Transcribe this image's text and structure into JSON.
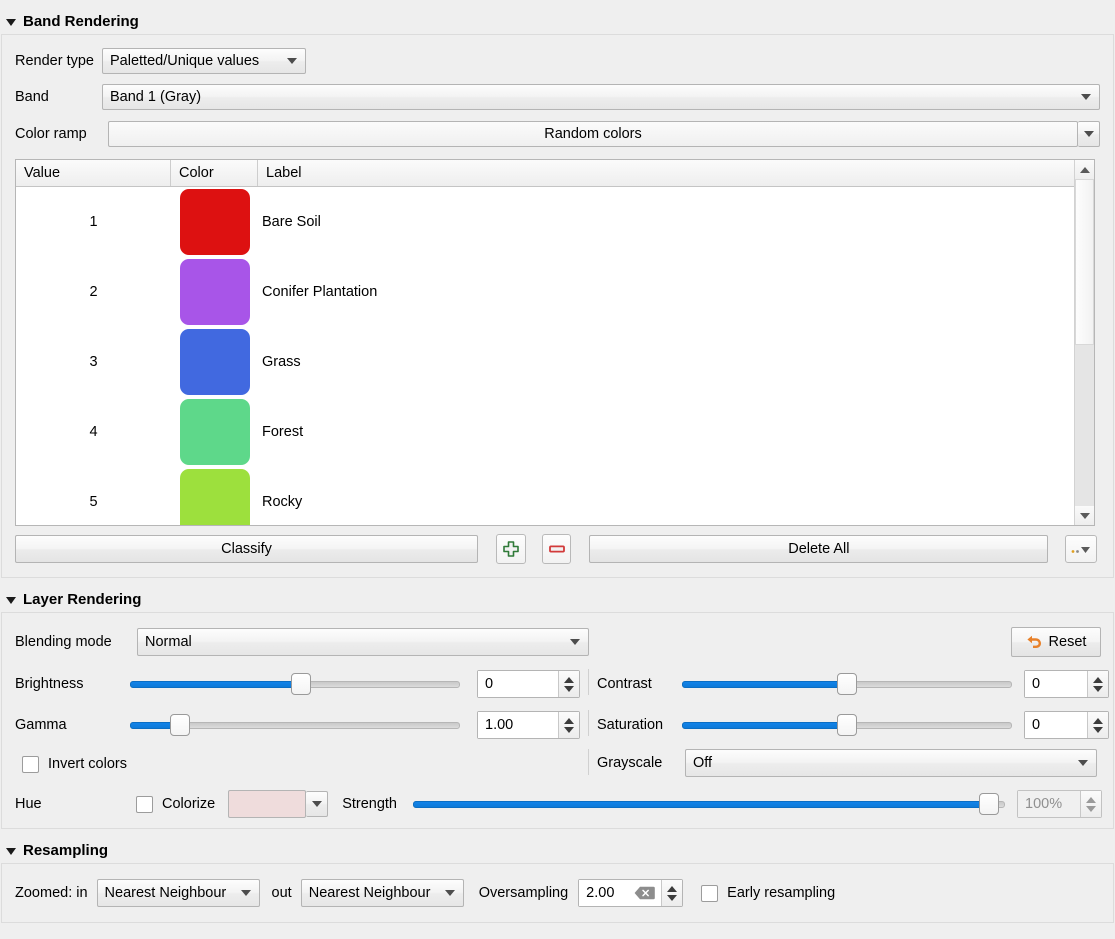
{
  "sections": {
    "band_rendering": {
      "title": "Band Rendering",
      "render_type_label": "Render type",
      "render_type_value": "Paletted/Unique values",
      "band_label": "Band",
      "band_value": "Band 1 (Gray)",
      "color_ramp_label": "Color ramp",
      "color_ramp_value": "Random colors",
      "table": {
        "columns": [
          "Value",
          "Color",
          "Label"
        ],
        "rows": [
          {
            "value": "1",
            "color": "#dd1111",
            "label": "Bare Soil"
          },
          {
            "value": "2",
            "color": "#a855e8",
            "label": "Conifer Plantation"
          },
          {
            "value": "3",
            "color": "#4169e0",
            "label": "Grass"
          },
          {
            "value": "4",
            "color": "#5ed88a",
            "label": "Forest"
          },
          {
            "value": "5",
            "color": "#9de03d",
            "label": "Rocky"
          }
        ]
      },
      "buttons": {
        "classify": "Classify",
        "add": "add-entry",
        "remove": "remove-entry",
        "delete_all": "Delete All",
        "menu": "..."
      }
    },
    "layer_rendering": {
      "title": "Layer Rendering",
      "blending_mode_label": "Blending mode",
      "blending_mode_value": "Normal",
      "reset_label": "Reset",
      "brightness_label": "Brightness",
      "brightness_value": "0",
      "brightness_pct": 52,
      "contrast_label": "Contrast",
      "contrast_value": "0",
      "contrast_pct": 50,
      "gamma_label": "Gamma",
      "gamma_value": "1.00",
      "gamma_pct": 13,
      "saturation_label": "Saturation",
      "saturation_value": "0",
      "saturation_pct": 50,
      "invert_colors_label": "Invert colors",
      "invert_colors_checked": false,
      "grayscale_label": "Grayscale",
      "grayscale_value": "Off",
      "hue_label": "Hue",
      "colorize_label": "Colorize",
      "colorize_checked": false,
      "colorize_color": "#efdcdc",
      "strength_label": "Strength",
      "strength_value": "100%",
      "strength_pct": 99
    },
    "resampling": {
      "title": "Resampling",
      "zoomed_label": "Zoomed: in",
      "zoomed_in_value": "Nearest Neighbour",
      "out_label": "out",
      "zoomed_out_value": "Nearest Neighbour",
      "oversampling_label": "Oversampling",
      "oversampling_value": "2.00",
      "early_resampling_label": "Early resampling",
      "early_resampling_checked": false
    }
  },
  "colors": {
    "accent_blue": "#0e7ad8",
    "panel_bg": "#efefef",
    "reset_orange": "#e8812a"
  }
}
